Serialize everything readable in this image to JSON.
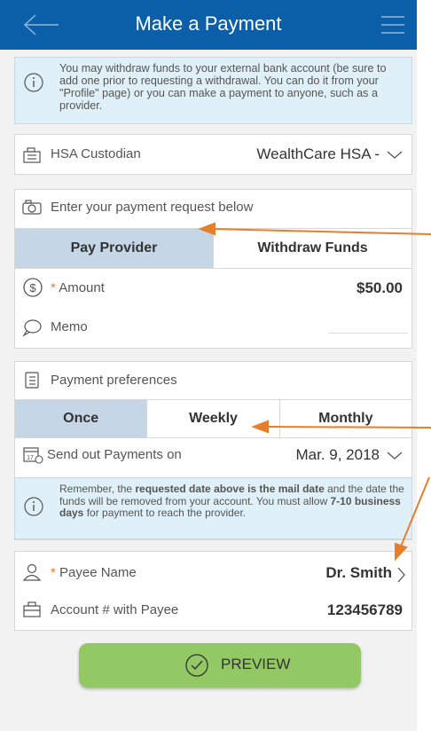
{
  "header": {
    "title": "Make a Payment"
  },
  "info_top": "You may withdraw funds to your external bank account (be sure to add one prior to requesting a withdrawal. You can do it from your \"Profile\" page) or you can make a payment to anyone, such as a provider.",
  "custodian": {
    "label": "HSA Custodian",
    "value": "WealthCare HSA -"
  },
  "request": {
    "heading": "Enter your payment request below",
    "tabs": [
      "Pay Provider",
      "Withdraw Funds"
    ],
    "active_tab": "Pay Provider",
    "amount_label": "Amount",
    "amount_value": "$50.00",
    "memo_label": "Memo"
  },
  "preferences": {
    "heading": "Payment preferences",
    "frequency": [
      "Once",
      "Weekly",
      "Monthly"
    ],
    "active_frequency": "Once",
    "send_label": "Send out Payments on",
    "send_date": "Mar. 9, 2018"
  },
  "info_mid": {
    "t1": "Remember, the ",
    "b1": "requested date above is the mail date",
    "t2": " and the date the funds will be removed from your account. You must allow ",
    "b2": "7-10 business days",
    "t3": " for payment to reach the provider."
  },
  "payee": {
    "name_label": "Payee Name",
    "name_value": "Dr. Smith",
    "account_label": "Account # with Payee",
    "account_value": "123456789"
  },
  "preview_button": "PREVIEW",
  "required_mark": "*",
  "colors": {
    "header": "#0b5fa8",
    "accent": "#e57f2b",
    "button": "#93c964",
    "info_bg": "#dff0f8"
  }
}
